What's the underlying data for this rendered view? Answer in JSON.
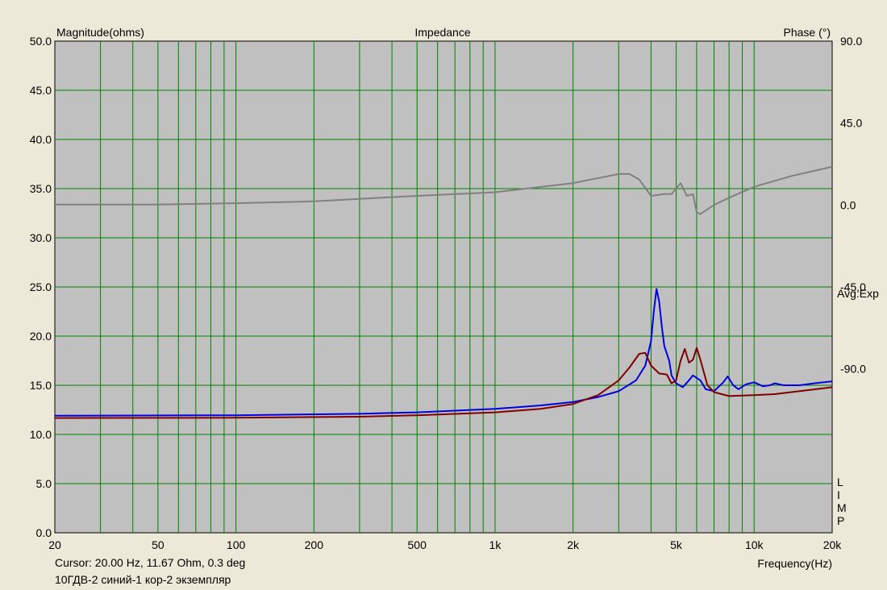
{
  "chart_data": {
    "type": "line",
    "title": "Impedance",
    "ylabel_left": "Magnitude(ohms)",
    "ylabel_right": "Phase (°)",
    "xlabel": "Frequency(Hz)",
    "x_scale": "log",
    "xlim": [
      20,
      20000
    ],
    "ylim_left": [
      0,
      50
    ],
    "ylim_right": [
      -180,
      90
    ],
    "grid": true,
    "x_tick_labels": [
      {
        "v": 20,
        "label": "20"
      },
      {
        "v": 50,
        "label": "50"
      },
      {
        "v": 100,
        "label": "100"
      },
      {
        "v": 200,
        "label": "200"
      },
      {
        "v": 500,
        "label": "500"
      },
      {
        "v": 1000,
        "label": "1k"
      },
      {
        "v": 2000,
        "label": "2k"
      },
      {
        "v": 5000,
        "label": "5k"
      },
      {
        "v": 10000,
        "label": "10k"
      },
      {
        "v": 20000,
        "label": "20k"
      }
    ],
    "x_grid": [
      30,
      40,
      50,
      60,
      70,
      80,
      90,
      100,
      200,
      300,
      400,
      500,
      600,
      700,
      800,
      900,
      1000,
      2000,
      3000,
      4000,
      5000,
      6000,
      7000,
      8000,
      9000,
      10000
    ],
    "y_ticks_left": [
      {
        "v": 0,
        "label": "0.0"
      },
      {
        "v": 5,
        "label": "5.0"
      },
      {
        "v": 10,
        "label": "10.0"
      },
      {
        "v": 15,
        "label": "15.0"
      },
      {
        "v": 20,
        "label": "20.0"
      },
      {
        "v": 25,
        "label": "25.0"
      },
      {
        "v": 30,
        "label": "30.0"
      },
      {
        "v": 35,
        "label": "35.0"
      },
      {
        "v": 40,
        "label": "40.0"
      },
      {
        "v": 45,
        "label": "45.0"
      },
      {
        "v": 50,
        "label": "50.0"
      }
    ],
    "y_ticks_right": [
      {
        "v": 90,
        "label": "90.0"
      },
      {
        "v": 45,
        "label": "45.0"
      },
      {
        "v": 0,
        "label": "0.0"
      },
      {
        "v": -45,
        "label": "-45.0"
      },
      {
        "v": -90,
        "label": "-90.0"
      }
    ],
    "right_annotations": [
      "Avg:Exp",
      "L",
      "I",
      "M",
      "P"
    ],
    "series": [
      {
        "axis": "right",
        "color": "#808080",
        "points": [
          [
            20,
            0.3
          ],
          [
            50,
            0.3
          ],
          [
            100,
            1
          ],
          [
            200,
            2
          ],
          [
            500,
            5
          ],
          [
            1000,
            7
          ],
          [
            2000,
            12
          ],
          [
            3000,
            17
          ],
          [
            3300,
            17
          ],
          [
            3600,
            14
          ],
          [
            4000,
            5
          ],
          [
            4500,
            6
          ],
          [
            4800,
            6
          ],
          [
            5200,
            12
          ],
          [
            5500,
            5
          ],
          [
            5800,
            6
          ],
          [
            6000,
            -4
          ],
          [
            6200,
            -5
          ],
          [
            7000,
            0
          ],
          [
            8000,
            4
          ],
          [
            10000,
            10
          ],
          [
            14000,
            16
          ],
          [
            20000,
            21
          ]
        ]
      },
      {
        "axis": "left",
        "color": "#0000e0",
        "points": [
          [
            20,
            11.9
          ],
          [
            100,
            11.95
          ],
          [
            300,
            12.1
          ],
          [
            500,
            12.25
          ],
          [
            1000,
            12.6
          ],
          [
            1500,
            12.95
          ],
          [
            2000,
            13.3
          ],
          [
            2500,
            13.8
          ],
          [
            3000,
            14.4
          ],
          [
            3500,
            15.5
          ],
          [
            3800,
            17
          ],
          [
            4000,
            19.5
          ],
          [
            4100,
            22.5
          ],
          [
            4200,
            24.8
          ],
          [
            4300,
            23.5
          ],
          [
            4400,
            21
          ],
          [
            4500,
            19
          ],
          [
            4700,
            17.5
          ],
          [
            4800,
            16
          ],
          [
            5000,
            15.2
          ],
          [
            5300,
            14.8
          ],
          [
            5600,
            15.5
          ],
          [
            5800,
            16
          ],
          [
            6200,
            15.5
          ],
          [
            6500,
            14.6
          ],
          [
            7000,
            14.4
          ],
          [
            7600,
            15.3
          ],
          [
            7900,
            15.9
          ],
          [
            8300,
            15
          ],
          [
            8700,
            14.6
          ],
          [
            9300,
            15.1
          ],
          [
            10000,
            15.3
          ],
          [
            10800,
            14.9
          ],
          [
            11500,
            15
          ],
          [
            12000,
            15.2
          ],
          [
            13000,
            15
          ],
          [
            15000,
            15
          ],
          [
            17000,
            15.2
          ],
          [
            20000,
            15.4
          ]
        ]
      },
      {
        "axis": "left",
        "color": "#800000",
        "points": [
          [
            20,
            11.67
          ],
          [
            100,
            11.7
          ],
          [
            300,
            11.8
          ],
          [
            500,
            11.95
          ],
          [
            1000,
            12.25
          ],
          [
            1500,
            12.6
          ],
          [
            2000,
            13.1
          ],
          [
            2500,
            14
          ],
          [
            3000,
            15.5
          ],
          [
            3300,
            16.8
          ],
          [
            3600,
            18.2
          ],
          [
            3800,
            18.3
          ],
          [
            4000,
            17
          ],
          [
            4300,
            16.2
          ],
          [
            4600,
            16.1
          ],
          [
            4800,
            15.2
          ],
          [
            5000,
            15.5
          ],
          [
            5200,
            17.5
          ],
          [
            5400,
            18.7
          ],
          [
            5600,
            17.3
          ],
          [
            5800,
            17.6
          ],
          [
            6000,
            18.8
          ],
          [
            6200,
            17.6
          ],
          [
            6600,
            15
          ],
          [
            7000,
            14.3
          ],
          [
            8000,
            13.9
          ],
          [
            9000,
            13.95
          ],
          [
            10000,
            14
          ],
          [
            12000,
            14.1
          ],
          [
            15000,
            14.4
          ],
          [
            20000,
            14.8
          ]
        ]
      }
    ]
  },
  "footer": {
    "cursor": "Cursor: 20.00 Hz, 11.67 Ohm, 0.3 deg",
    "label": "10ГДВ-2 синий-1 кор-2 экземпляр"
  }
}
